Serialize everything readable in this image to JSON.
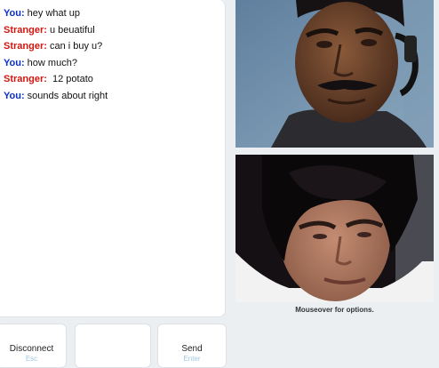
{
  "chat": {
    "messages": [
      {
        "sender": "You:",
        "type": "you",
        "text": " hey what up"
      },
      {
        "sender": "Stranger:",
        "type": "stranger",
        "text": " u beuatiful"
      },
      {
        "sender": "Stranger:",
        "type": "stranger",
        "text": " can i buy u?"
      },
      {
        "sender": "You:",
        "type": "you",
        "text": " how much?"
      },
      {
        "sender": "Stranger:",
        "type": "stranger",
        "text": "  12 potato"
      },
      {
        "sender": "You:",
        "type": "you",
        "text": " sounds about right"
      }
    ]
  },
  "video": {
    "options_hint": "Mouseover for options."
  },
  "controls": {
    "disconnect_label": "Disconnect",
    "disconnect_hint": "Esc",
    "send_label": "Send",
    "send_hint": "Enter",
    "message_value": ""
  },
  "colors": {
    "you": "#0a2fd0",
    "stranger": "#d3160f",
    "background": "#eceff2",
    "hint": "#9ec6de"
  }
}
